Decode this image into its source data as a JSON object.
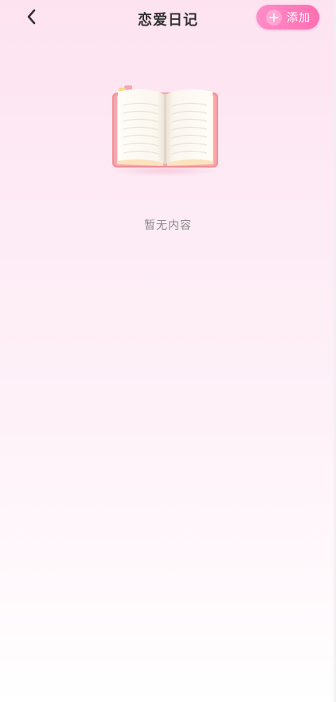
{
  "header": {
    "title": "恋爱日记",
    "back_icon": "chevron-left-icon",
    "add_button": {
      "label": "添加",
      "icon": "plus-icon"
    }
  },
  "empty_state": {
    "illustration": "open-book-icon",
    "message": "暂无内容"
  },
  "colors": {
    "accent_pink": "#ff6fb2",
    "background_top": "#fde3f0",
    "background_bottom": "#ffffff",
    "title_text": "#333333",
    "muted_text": "#8a8a8a"
  }
}
